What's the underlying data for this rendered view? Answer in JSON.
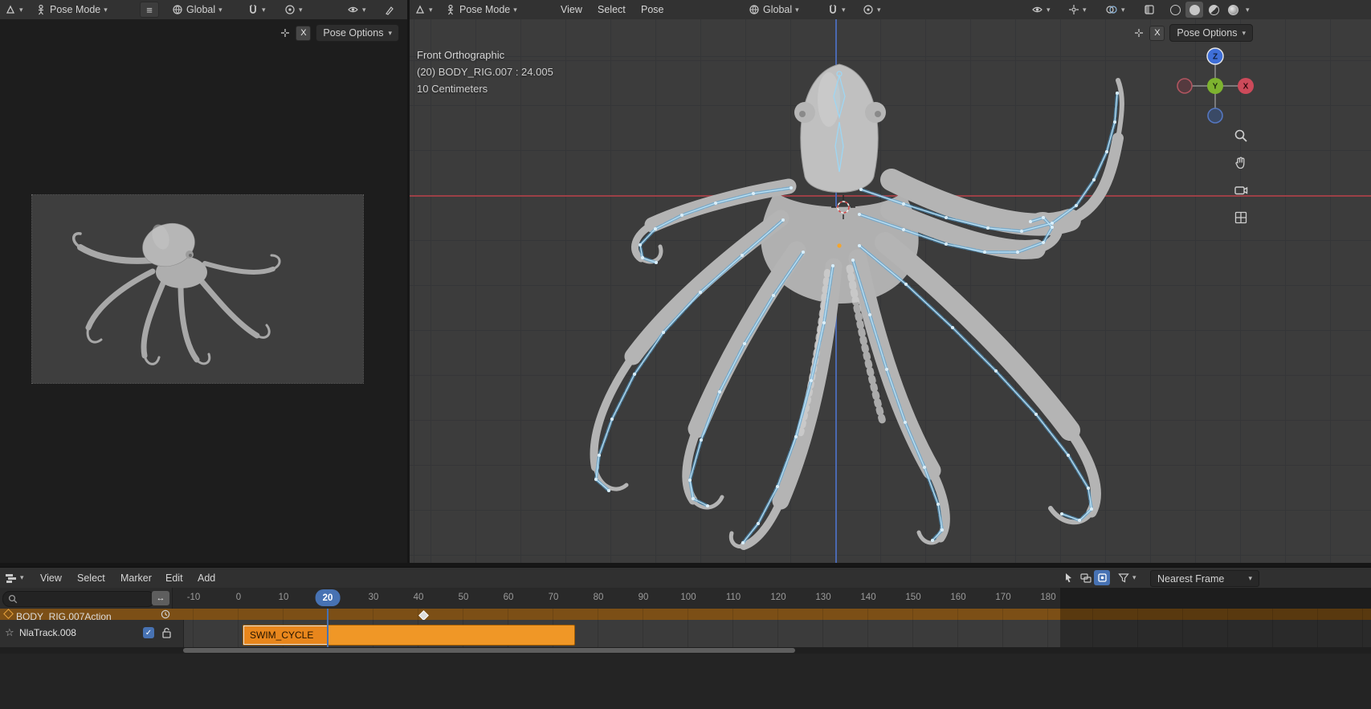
{
  "colors": {
    "accent_blue": "#4772b3",
    "strip_orange": "#f09726",
    "bone_blue": "#7fc4e8",
    "axis_red": "#9c4046",
    "axis_blue": "#4b69b0"
  },
  "icons": {
    "chevron_down": "▾",
    "hamburger": "≡",
    "double_arrow": "↔",
    "star": "☆",
    "check": "✓"
  },
  "viewport_left": {
    "header": {
      "mode": "Pose Mode",
      "orientation": "Global"
    },
    "tool_row": {
      "mirror_x": "X",
      "pose_options": "Pose Options"
    }
  },
  "viewport_right": {
    "header": {
      "mode": "Pose Mode",
      "menus": [
        "View",
        "Select",
        "Pose"
      ],
      "orientation": "Global"
    },
    "tool_row": {
      "mirror_x": "X",
      "pose_options": "Pose Options"
    },
    "overlay": {
      "view": "Front Orthographic",
      "context": "(20) BODY_RIG.007 : 24.005",
      "scale": "10 Centimeters"
    },
    "gizmo": {
      "x": "X",
      "y": "Y",
      "z": "Z"
    }
  },
  "timeline": {
    "menus": [
      "View",
      "Select",
      "Marker",
      "Edit",
      "Add"
    ],
    "snap_mode": "Nearest Frame",
    "current_frame": "20",
    "ruler_ticks": [
      "-10",
      "0",
      "10",
      "20",
      "30",
      "40",
      "50",
      "60",
      "70",
      "80",
      "90",
      "100",
      "110",
      "120",
      "130",
      "140",
      "150",
      "160",
      "170",
      "180"
    ],
    "tracks": [
      {
        "name": "BODY_RIG.007Action",
        "type": "action"
      },
      {
        "name": "NlaTrack.008",
        "type": "nla",
        "strip": "SWIM_CYCLE"
      }
    ]
  }
}
